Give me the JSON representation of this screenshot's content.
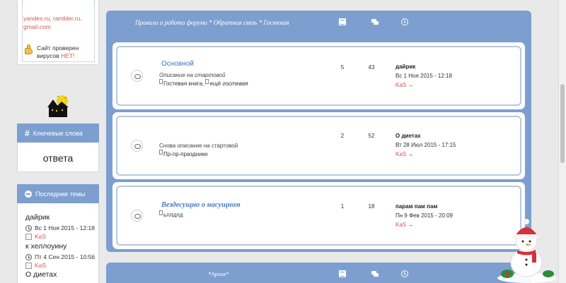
{
  "sidebar": {
    "email_note": [
      "yandex.ru, rambler.ru,",
      "gmail.com"
    ],
    "checked_note": {
      "line1": "Сайт проверен",
      "line2": "вирусов",
      "status": "НЕТ!"
    },
    "keywords": {
      "title": "Ключевые слова",
      "word": "ответа"
    },
    "latest_topics": {
      "title": "Последние темы",
      "items": [
        {
          "topic": "дайрик",
          "date": "Вс 1 Ноя 2015 - 12:18",
          "user": "KaS"
        },
        {
          "topic": "к хеллоуину",
          "date": "Пт 4 Сен 2015 - 10:56",
          "user": "KaS"
        },
        {
          "topic": "О диетах"
        }
      ]
    }
  },
  "category1": {
    "title": "Правила и работа форума * Обратная связь * Гостевая",
    "header_icons": [
      "topics-icon",
      "posts-icon",
      "last-post-icon"
    ],
    "forums": [
      {
        "name": "Основной",
        "description": "Описание на стартовой",
        "subforums": [
          {
            "label": "Гостевая книга,",
            "italic": false
          },
          {
            "label": "ещё гостевая",
            "italic": true
          }
        ],
        "topics": "5",
        "posts": "43",
        "last_title": "дайрик",
        "last_date": "Вс 1 Ноя 2015 - 12:18",
        "last_user": "KaS",
        "arrow": "→"
      },
      {
        "name": "",
        "description": "Снова описание на стартовой",
        "subforums": [
          {
            "label": "Пр-пр-праздники",
            "italic": false
          }
        ],
        "topics": "2",
        "posts": "52",
        "last_title": "О диетах",
        "last_date": "Вт 28 Июл 2015 - 17:15",
        "last_user": "KaS",
        "arrow": "→"
      },
      {
        "name": "Вездесущно о насущном",
        "description": "",
        "subforums": [
          {
            "label": "ьллдлд",
            "italic": false
          }
        ],
        "topics": "1",
        "posts": "18",
        "last_title": "парам пам пам",
        "last_date": "Пн 9 Фев 2015 - 20:09",
        "last_user": "KaS",
        "arrow": "→"
      }
    ]
  },
  "category2": {
    "title": "*Архив*"
  },
  "colors": {
    "accent": "#7d9fcf",
    "link": "#3576c9",
    "user": "#d9534f"
  }
}
